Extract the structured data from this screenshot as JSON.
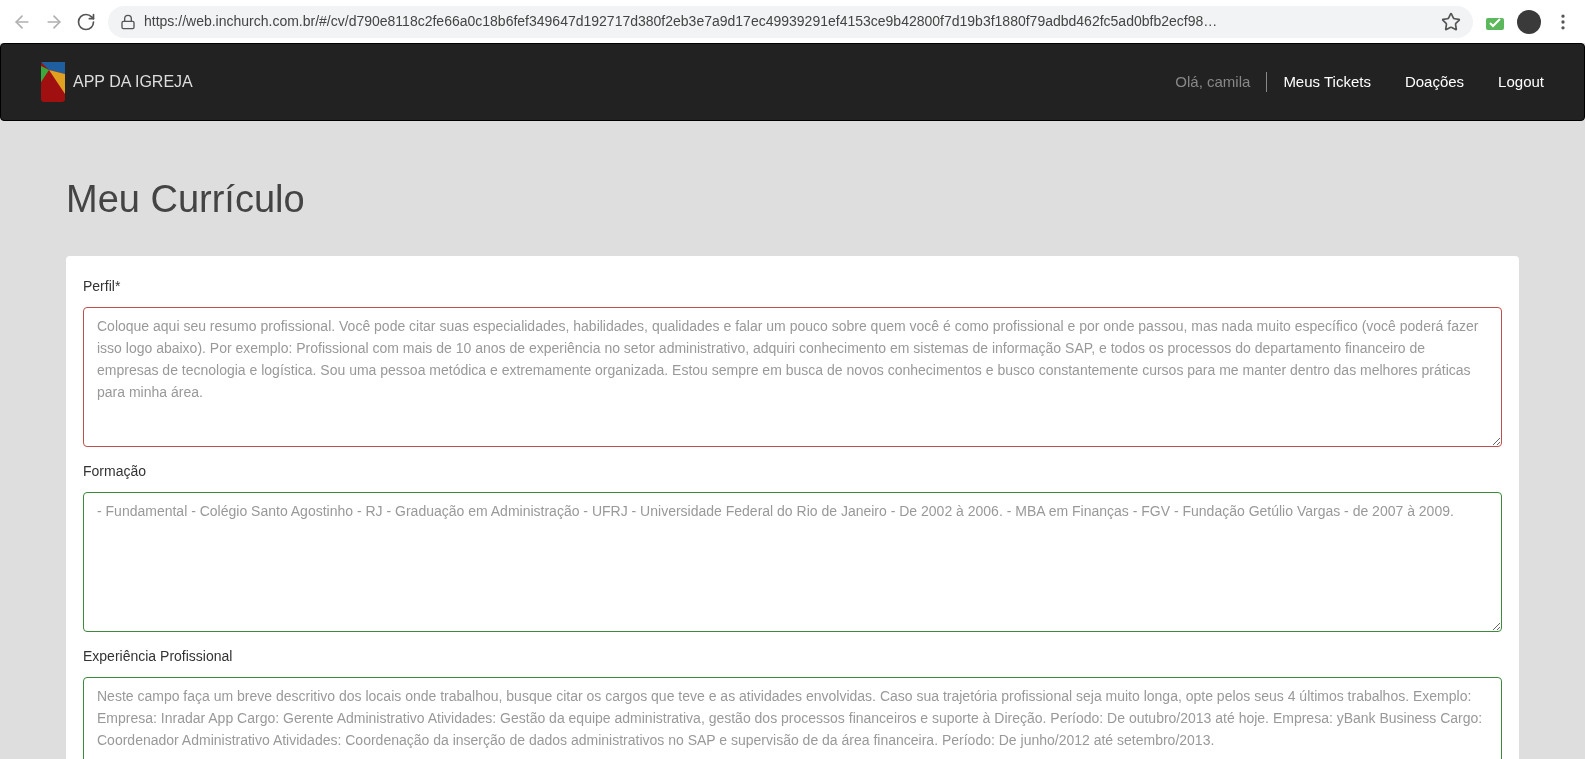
{
  "browser": {
    "url": "https://web.inchurch.com.br/#/cv/d790e8118c2fe66a0c18b6fef349647d192717d380f2eb3e7a9d17ec49939291ef4153ce9b42800f7d19b3f1880f79adbd462fc5ad0bfb2ecf98…"
  },
  "navbar": {
    "brand": "APP DA IGREJA",
    "greeting": "Olá, camila",
    "links": [
      "Meus Tickets",
      "Doações",
      "Logout"
    ]
  },
  "page": {
    "title": "Meu Currículo"
  },
  "fields": [
    {
      "label": "Perfil*",
      "invalid": true,
      "placeholder": "Coloque aqui seu resumo profissional. Você pode citar suas especialidades, habilidades, qualidades e falar um pouco sobre quem você é como profissional e por onde passou, mas nada muito específico (você poderá fazer isso logo abaixo). Por exemplo: Profissional com mais de 10 anos de experiência no setor administrativo, adquiri conhecimento em sistemas de informação SAP, e todos os processos do departamento financeiro de empresas de tecnologia e logística. Sou uma pessoa metódica e extremamente organizada. Estou sempre em busca de novos conhecimentos e busco constantemente cursos para me manter dentro das melhores práticas para minha área."
    },
    {
      "label": "Formação",
      "invalid": false,
      "placeholder": "- Fundamental - Colégio Santo Agostinho - RJ - Graduação em Administração - UFRJ - Universidade Federal do Rio de Janeiro - De 2002 à 2006. - MBA em Finanças - FGV - Fundação Getúlio Vargas - de 2007 à 2009."
    },
    {
      "label": "Experiência Profissional",
      "invalid": false,
      "placeholder": "Neste campo faça um breve descritivo dos locais onde trabalhou, busque citar os cargos que teve e as atividades envolvidas. Caso sua trajetória profissional seja muito longa, opte pelos seus 4 últimos trabalhos. Exemplo: Empresa: Inradar App Cargo: Gerente Administrativo Atividades: Gestão da equipe administrativa, gestão dos processos financeiros e suporte à Direção. Período: De outubro/2013 até hoje. Empresa: yBank Business Cargo: Coordenador Administrativo Atividades: Coordenação da inserção de dados administrativos no SAP e supervisão de da área financeira. Período: De junho/2012 até setembro/2013."
    }
  ]
}
